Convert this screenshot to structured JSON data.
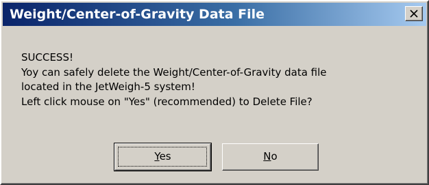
{
  "window": {
    "title": "Weight/Center-of-Gravity Data File",
    "close_icon": "close-icon"
  },
  "message": {
    "lines": [
      "SUCCESS!",
      "Yoy can safely delete the Weight/Center-of-Gravity data file",
      "located in the JetWeigh-5 system!",
      "Left click mouse on \"Yes\" (recommended) to Delete File?"
    ]
  },
  "buttons": {
    "yes": {
      "mnemonic": "Y",
      "rest": "es"
    },
    "no": {
      "mnemonic": "N",
      "rest": "o"
    }
  },
  "colors": {
    "dialog_face": "#d4d0c8",
    "titlebar_start": "#0a246a",
    "titlebar_end": "#a6caf0",
    "title_text": "#ffffff"
  }
}
